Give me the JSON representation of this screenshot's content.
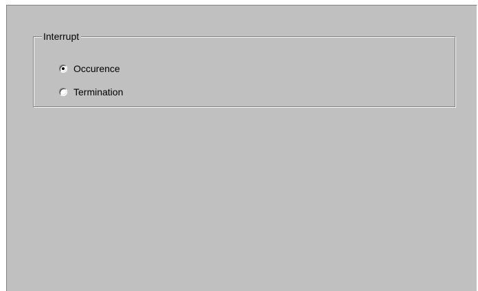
{
  "interrupt_group": {
    "title": "Interrupt",
    "options": [
      {
        "label": "Occurence",
        "selected": true
      },
      {
        "label": "Termination",
        "selected": false
      }
    ]
  }
}
